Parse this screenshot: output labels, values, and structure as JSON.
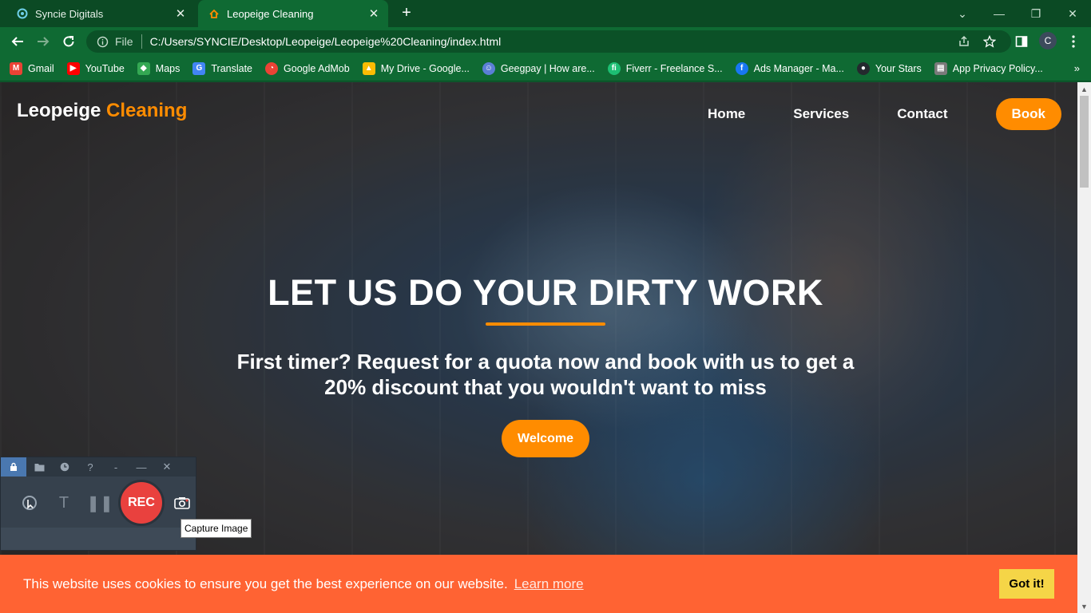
{
  "browser": {
    "tabs": [
      {
        "title": "Syncie Digitals",
        "close": "✕"
      },
      {
        "title": "Leopeige Cleaning",
        "close": "✕"
      }
    ],
    "new_tab": "+",
    "window_controls": {
      "dropdown": "⌄",
      "minimize": "—",
      "restore": "❐",
      "close": "✕"
    },
    "address": {
      "info_label": "File",
      "url": "C:/Users/SYNCIE/Desktop/Leopeige/Leopeige%20Cleaning/index.html"
    },
    "profile_initial": "C",
    "bookmarks": [
      {
        "label": "Gmail",
        "icon": "M",
        "color": "#ea4335"
      },
      {
        "label": "YouTube",
        "icon": "▶",
        "color": "#ff0000"
      },
      {
        "label": "Maps",
        "icon": "◆",
        "color": "#34a853"
      },
      {
        "label": "Translate",
        "icon": "G",
        "color": "#4285f4"
      },
      {
        "label": "Google AdMob",
        "icon": "◔",
        "color": "#ea4335"
      },
      {
        "label": "My Drive - Google...",
        "icon": "▲",
        "color": "#fbbc04"
      },
      {
        "label": "Geegpay | How are...",
        "icon": "☺",
        "color": "#5b7fd6"
      },
      {
        "label": "Fiverr - Freelance S...",
        "icon": "fi",
        "color": "#1dbf73"
      },
      {
        "label": "Ads Manager - Ma...",
        "icon": "f",
        "color": "#1877f2"
      },
      {
        "label": "Your Stars",
        "icon": "●",
        "color": "#24292e"
      },
      {
        "label": "App Privacy Policy...",
        "icon": "▤",
        "color": "#7a7a7a"
      }
    ],
    "bookmarks_more": "»"
  },
  "site": {
    "brand_main": "Leopeige",
    "brand_accent": "Cleaning",
    "nav": {
      "home": "Home",
      "services": "Services",
      "contact": "Contact",
      "book": "Book"
    },
    "hero": {
      "title": "LET US DO YOUR DIRTY WORK",
      "subtitle": "First timer? Request for a quota now and book with us to get a 20% discount that you wouldn't want to miss",
      "button": "Welcome"
    },
    "cookie": {
      "message": "This website uses cookies to ensure you get the best experience on our website.",
      "link": "Learn more",
      "button": "Got it!"
    },
    "accent_color": "#ff8c00",
    "cookie_color": "#ff6333"
  },
  "recorder": {
    "rec_label": "REC",
    "tooltip": "Capture Image",
    "top_icons": [
      "lock-icon",
      "folder-icon",
      "clock-icon",
      "help-icon",
      "collapse-icon",
      "minimize-icon",
      "close-icon"
    ]
  }
}
